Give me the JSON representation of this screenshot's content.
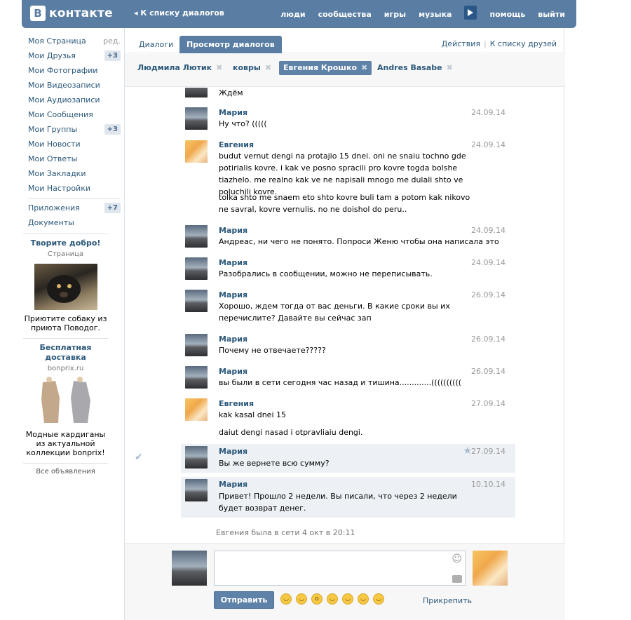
{
  "header": {
    "logo_letter": "В",
    "logo_text": "контакте",
    "back_link": "◂ К списку диалогов",
    "nav": [
      "люди",
      "сообщества",
      "игры",
      "музыка",
      "помощь",
      "выйти"
    ],
    "color_bg": "#597da3"
  },
  "sidebar": {
    "items": [
      {
        "label": "Моя Страница",
        "badge": "ред."
      },
      {
        "label": "Мои Друзья",
        "badge": "+3"
      },
      {
        "label": "Мои Фотографии",
        "badge": ""
      },
      {
        "label": "Мои Видеозаписи",
        "badge": ""
      },
      {
        "label": "Мои Аудиозаписи",
        "badge": ""
      },
      {
        "label": "Мои Сообщения",
        "badge": ""
      },
      {
        "label": "Мои Группы",
        "badge": "+3"
      },
      {
        "label": "Мои Новости",
        "badge": ""
      },
      {
        "label": "Мои Ответы",
        "badge": ""
      },
      {
        "label": "Мои Закладки",
        "badge": ""
      },
      {
        "label": "Мои Настройки",
        "badge": ""
      }
    ],
    "items2": [
      {
        "label": "Приложения",
        "badge": "+7"
      },
      {
        "label": "Документы",
        "badge": ""
      }
    ]
  },
  "ads": {
    "ad1_title": "Творите добро!",
    "ad1_sub": "Страница",
    "ad1_text": "Приютите собаку из приюта Поводог.",
    "ad2_title": "Бесплатная доставка",
    "ad2_sub": "bonprix.ru",
    "ad2_text": "Модные кардиганы из актуальной коллекции bonprix!",
    "all_ads": "Все объявления"
  },
  "tabs": {
    "dialogs": "Диалоги",
    "view": "Просмотр диалогов",
    "actions": "Действия",
    "to_friends": "К списку друзей"
  },
  "chips": [
    "Людмила Лютик",
    "ковры",
    "Евгения Крошко",
    "Andres Basabe"
  ],
  "messages": [
    {
      "author": "",
      "date": "",
      "lines": [
        "Ждём"
      ],
      "avatar": "m"
    },
    {
      "author": "Мария",
      "date": "24.09.14",
      "lines": [
        "Ну что? ((((("
      ],
      "avatar": "m"
    },
    {
      "author": "Евгения",
      "date": "24.09.14",
      "lines": [
        "budut vernut dengi na protajio 15 dnei. oni ne snaiu tochno gde potirialis kovre. i kak ve posno spracili pro kovre togda bolshe tiazhelo. me realno kak ve ne napisali mnogo me dulali shto ve poluchili kovre.",
        "tolka shto me snaem eto shto kovre buli tam a potom kak nikovo ne savral, kovre vernulis. no ne doishol do peru.."
      ],
      "avatar": "e"
    },
    {
      "author": "Мария",
      "date": "24.09.14",
      "lines": [
        "Андреас, ни чего не понято. Попроси Женю чтобы она написала это"
      ],
      "avatar": "m"
    },
    {
      "author": "Мария",
      "date": "24.09.14",
      "lines": [
        "Разобрались в сообщении, можно не переписывать."
      ],
      "avatar": "m"
    },
    {
      "author": "Мария",
      "date": "26.09.14",
      "lines": [
        "Хорошо, ждем тогда от вас деньги. В какие сроки вы их перечислите? Давайте вы сейчас зап"
      ],
      "avatar": "m"
    },
    {
      "author": "Мария",
      "date": "26.09.14",
      "lines": [
        "Почему не отвечаете?????"
      ],
      "avatar": "m"
    },
    {
      "author": "Мария",
      "date": "26.09.14",
      "lines": [
        "вы были в сети сегодня час назад и тишина.............(((((((((("
      ],
      "avatar": "m"
    },
    {
      "author": "Евгения",
      "date": "27.09.14",
      "lines": [
        "kak kasal dnei 15",
        "daiut dengi nasad i otpravliaiu dengi."
      ],
      "avatar": "e"
    },
    {
      "author": "Мария",
      "date": "27.09.14",
      "lines": [
        "Вы же вернете всю сумму?"
      ],
      "avatar": "m"
    },
    {
      "author": "Мария",
      "date": "10.10.14",
      "lines": [
        "Привет! Прошло 2 недели. Вы писали, что через 2 недели будет возврат денег."
      ],
      "avatar": "m"
    }
  ],
  "status": "Евгения была в сети 4 окт в 20:11",
  "composer": {
    "send": "Отправить",
    "attach": "Прикрепить"
  }
}
